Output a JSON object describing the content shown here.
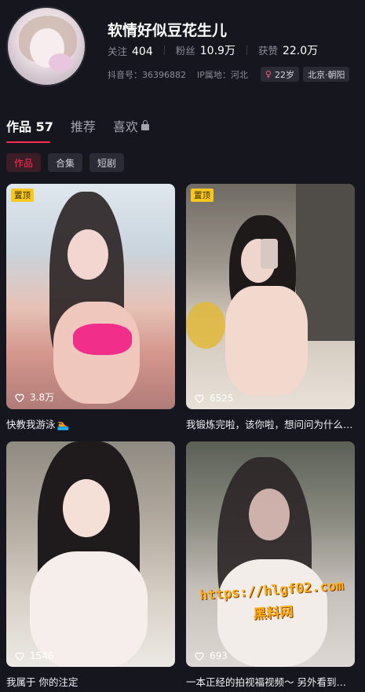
{
  "profile": {
    "name": "软情好似豆花生儿",
    "stats": [
      {
        "label": "关注",
        "value": "404"
      },
      {
        "label": "粉丝",
        "value": "10.9万"
      },
      {
        "label": "获赞",
        "value": "22.0万"
      }
    ],
    "douyin_id": "抖音号：36396882",
    "ip_location": "IP属地：河北",
    "age_chip": "22岁",
    "location_chip": "北京·朝阳",
    "accent_color": "#fe2c55"
  },
  "tabs": [
    {
      "label": "作品 57",
      "active": true
    },
    {
      "label": "推荐",
      "active": false
    },
    {
      "label": "喜欢",
      "active": false,
      "locked": true
    }
  ],
  "filters": [
    {
      "label": "作品",
      "active": true
    },
    {
      "label": "合集",
      "active": false
    },
    {
      "label": "短剧",
      "active": false
    }
  ],
  "videos": [
    {
      "pinned_label": "置顶",
      "likes": "3.8万",
      "caption": "快教我游泳",
      "caption_icon": "swimmer-emoji"
    },
    {
      "pinned_label": "置顶",
      "likes": "6525",
      "caption": "我锻炼完啦，该你啦，想问问为什么…"
    },
    {
      "likes": "1546",
      "caption": "我属于 你的注定"
    },
    {
      "likes": "693",
      "caption": "一本正经的拍视福视频～ 另外看到…",
      "watermark": {
        "url": "https://hlgf02.com",
        "text": "黑料网"
      }
    }
  ]
}
